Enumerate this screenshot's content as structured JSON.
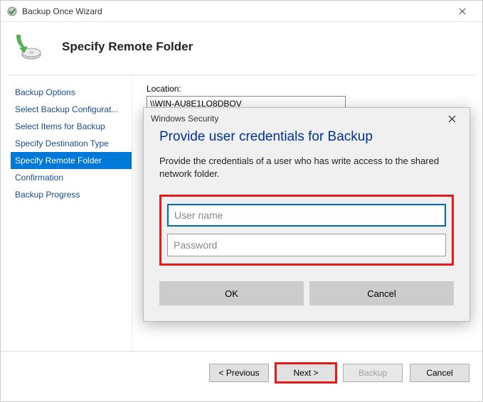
{
  "window": {
    "title": "Backup Once Wizard"
  },
  "header": {
    "title": "Specify Remote Folder"
  },
  "sidebar": {
    "items": [
      {
        "label": "Backup Options"
      },
      {
        "label": "Select Backup Configurat..."
      },
      {
        "label": "Select Items for Backup"
      },
      {
        "label": "Specify Destination Type"
      },
      {
        "label": "Specify Remote Folder"
      },
      {
        "label": "Confirmation"
      },
      {
        "label": "Backup Progress"
      }
    ],
    "active_index": 4
  },
  "main": {
    "location_label": "Location:",
    "location_value": "\\\\WIN-AU8E1LO8DBOV"
  },
  "footer": {
    "previous": "< Previous",
    "next": "Next >",
    "backup": "Backup",
    "cancel": "Cancel"
  },
  "dialog": {
    "titlebar": "Windows Security",
    "heading": "Provide user credentials for Backup",
    "text": "Provide the credentials of a user who has write access to the shared network folder.",
    "username_placeholder": "User name",
    "username_value": "",
    "password_placeholder": "Password",
    "password_value": "",
    "ok": "OK",
    "cancel": "Cancel"
  }
}
